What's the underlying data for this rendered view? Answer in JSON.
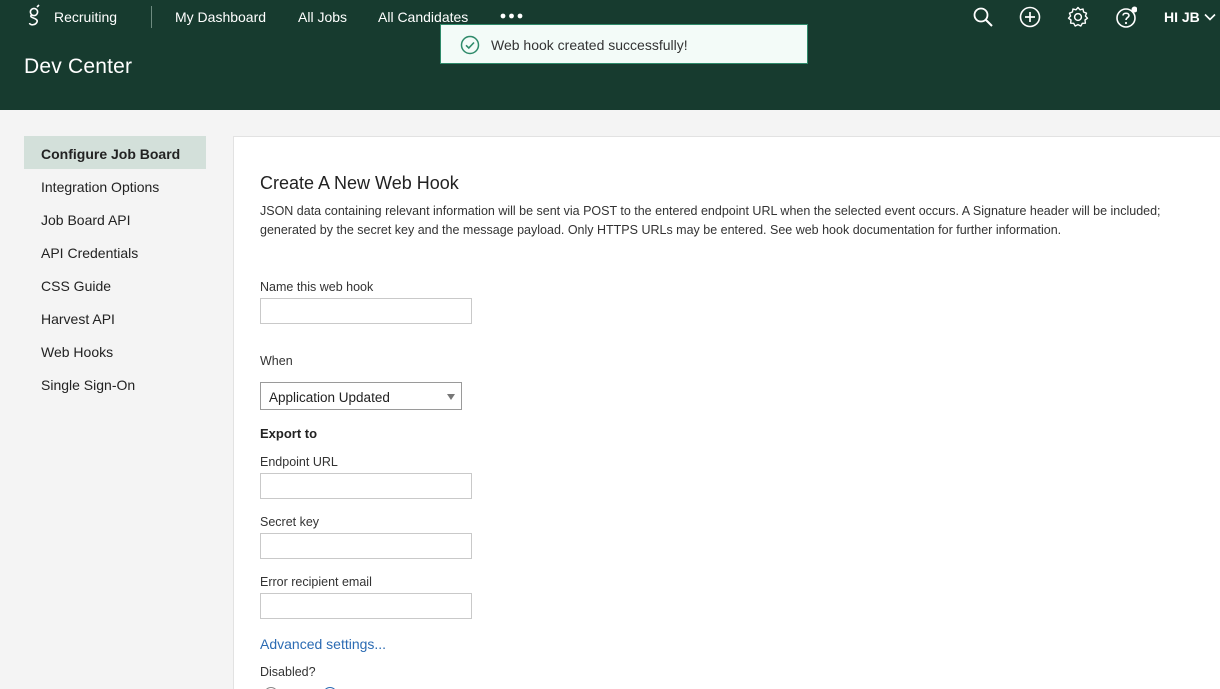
{
  "header": {
    "brand": "Recruiting",
    "nav": [
      "My Dashboard",
      "All Jobs",
      "All Candidates"
    ],
    "user": "HI JB",
    "page_title": "Dev Center",
    "icons": [
      "search-icon",
      "add-circle-icon",
      "gear-icon",
      "help-icon",
      "chevron-down-icon"
    ]
  },
  "toast": {
    "message": "Web hook created successfully!"
  },
  "sidebar": {
    "items": [
      {
        "label": "Configure Job Board",
        "active": true
      },
      {
        "label": "Integration Options",
        "active": false
      },
      {
        "label": "Job Board API",
        "active": false
      },
      {
        "label": "API Credentials",
        "active": false
      },
      {
        "label": "CSS Guide",
        "active": false
      },
      {
        "label": "Harvest API",
        "active": false
      },
      {
        "label": "Web Hooks",
        "active": false
      },
      {
        "label": "Single Sign-On",
        "active": false
      }
    ]
  },
  "form": {
    "title": "Create A New Web Hook",
    "description": "JSON data containing relevant information will be sent via POST to the entered endpoint URL when the selected event occurs. A Signature header will be included; generated by the secret key and the message payload. Only HTTPS URLs may be entered. See web hook documentation for further information.",
    "name_label": "Name this web hook",
    "name_value": "",
    "when_label": "When",
    "when_selected": "Application Updated",
    "export_heading": "Export to",
    "endpoint_label": "Endpoint URL",
    "endpoint_value": "",
    "secret_label": "Secret key",
    "secret_value": "",
    "error_email_label": "Error recipient email",
    "error_email_value": "",
    "advanced_link": "Advanced settings...",
    "disabled_label": "Disabled?",
    "disabled_selected": "No"
  },
  "colors": {
    "header_bg": "#173b2f",
    "active_sidebar_bg": "#d3e0da",
    "link": "#2b6bb3",
    "toast_border": "#2e8a6a"
  }
}
